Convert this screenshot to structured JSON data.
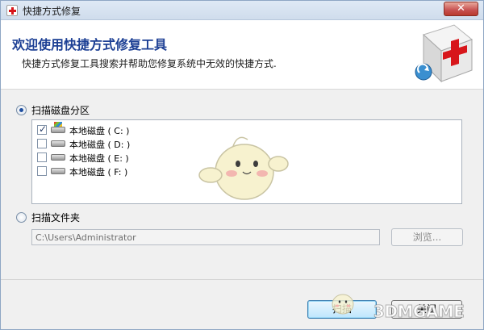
{
  "window": {
    "title": "快捷方式修复",
    "close_label": "✕"
  },
  "header": {
    "title": "欢迎使用快捷方式修复工具",
    "description": "快捷方式修复工具搜索并帮助您修复系统中无效的快捷方式."
  },
  "scan_disk": {
    "label": "扫描磁盘分区",
    "selected": true,
    "drives": [
      {
        "label": "本地磁盘 ( C: )",
        "checked": true,
        "icon": "system-drive-icon"
      },
      {
        "label": "本地磁盘 ( D: )",
        "checked": false,
        "icon": "drive-icon"
      },
      {
        "label": "本地磁盘 ( E: )",
        "checked": false,
        "icon": "drive-icon"
      },
      {
        "label": "本地磁盘 ( F: )",
        "checked": false,
        "icon": "drive-icon"
      }
    ]
  },
  "scan_folder": {
    "label": "扫描文件夹",
    "selected": false,
    "path_value": "C:\\Users\\Administrator",
    "browse_label": "浏览..."
  },
  "footer": {
    "scan_label": "扫描",
    "close_label": "关闭",
    "watermark": "3DMGAME"
  },
  "colors": {
    "title_blue": "#1c3f94",
    "close_red": "#c75050",
    "cross_red": "#d7161b"
  }
}
